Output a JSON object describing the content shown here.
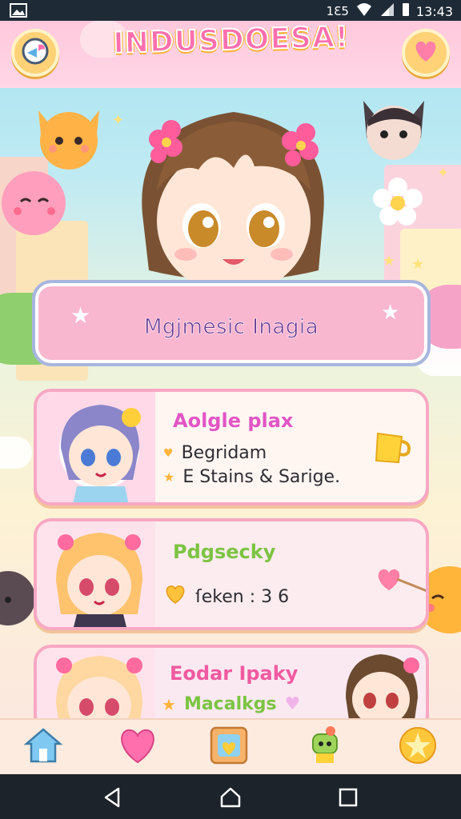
{
  "status_bar": {
    "time": "13:43",
    "signal_label": "1Ɛ5"
  },
  "header": {
    "title": "INDUSDOESA!",
    "left_button_icon": "back-chat-icon",
    "right_button_icon": "heart-icon"
  },
  "banner": {
    "text": "Mgjmesic Inagia"
  },
  "cards": [
    {
      "title": "Aolgle plax",
      "line1": "Begridam",
      "line2": "E Stains & Sarige.",
      "action_icon": "cup-icon",
      "title_color": "#e255c5"
    },
    {
      "title": "Pdgsecky",
      "line1": "ſeken : 3 6",
      "action_icon": "heart-arrow-icon",
      "title_color": "#7cc443"
    },
    {
      "title": "Eodar Ipaky",
      "line1": "Macalkgs",
      "title_color": "#f05aa0"
    }
  ],
  "bottom_nav": {
    "items": [
      {
        "icon": "home-icon"
      },
      {
        "icon": "heart-icon"
      },
      {
        "icon": "gallery-icon"
      },
      {
        "icon": "robot-icon"
      },
      {
        "icon": "star-icon"
      }
    ]
  },
  "system_nav": {
    "back": "back-icon",
    "home": "home-circle-icon",
    "recents": "recents-icon"
  },
  "colors": {
    "pink": "#f9b7cf",
    "accent": "#ff6fae",
    "gold": "#ffd277",
    "border": "#a7b6de"
  }
}
